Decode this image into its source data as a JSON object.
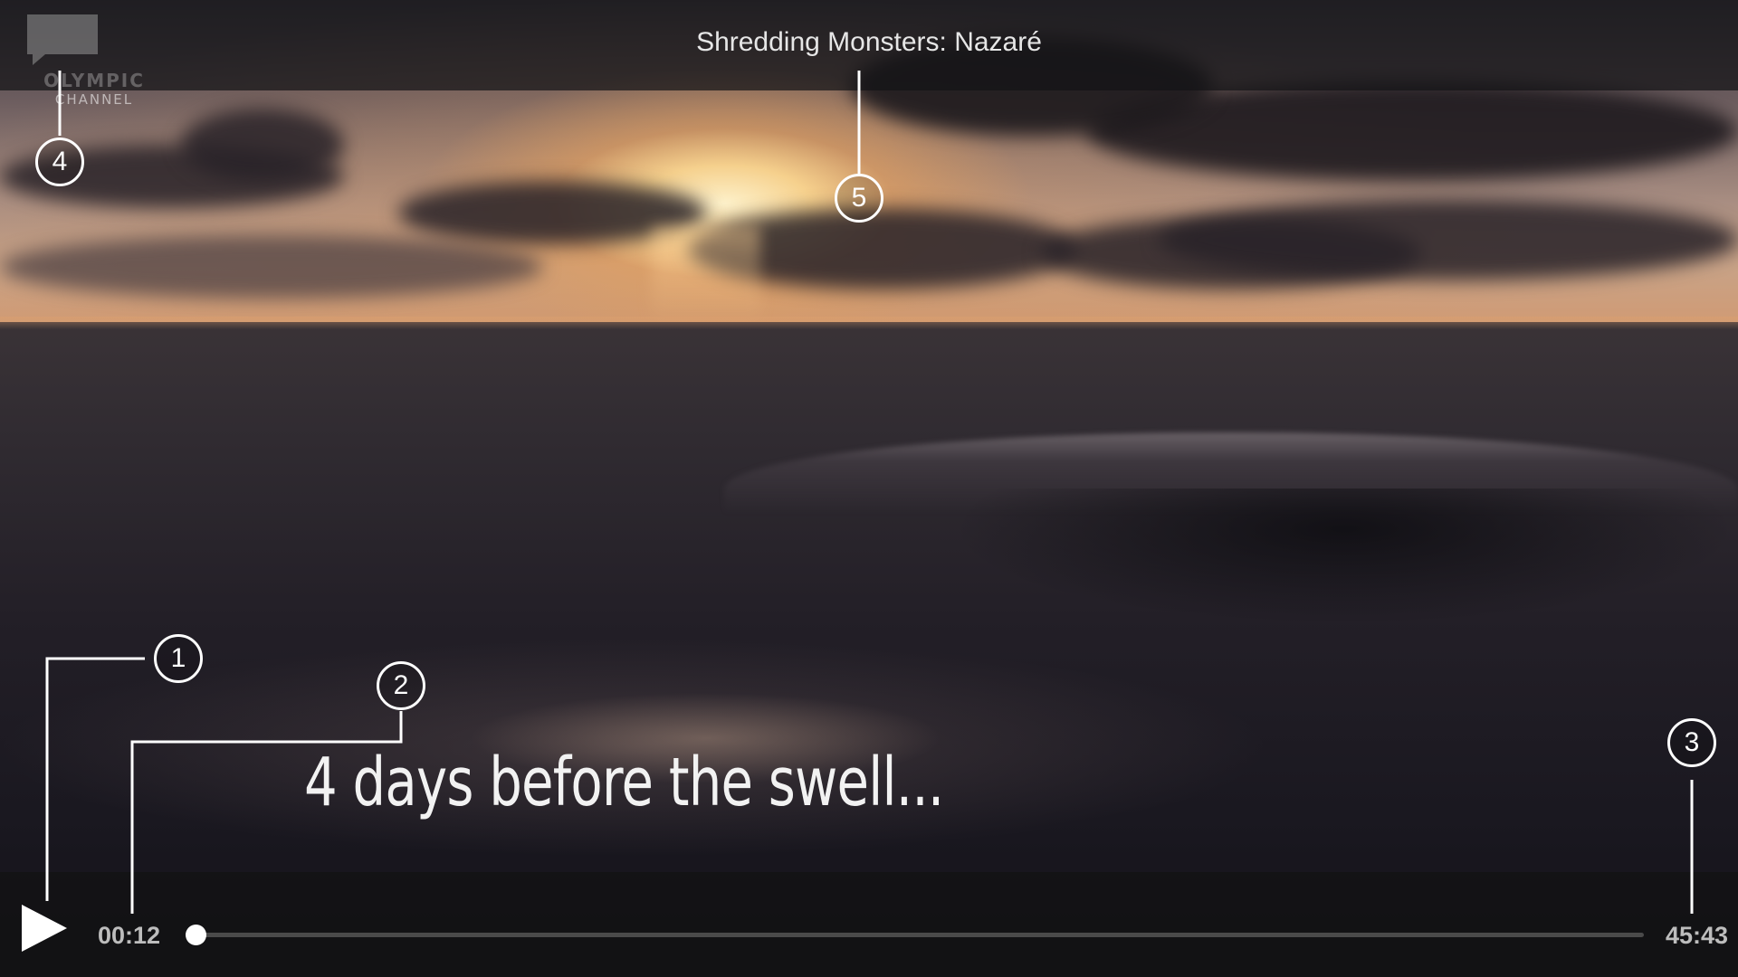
{
  "player": {
    "title": "Shredding Monsters: Nazaré",
    "subtitle_caption": "4 days before the swell...",
    "current_time": "00:12",
    "total_time": "45:43",
    "progress_fraction": 0.004,
    "watermark": {
      "line1": "OLYMPIC",
      "line2": "CHANNEL"
    },
    "icons": {
      "play": "play-icon",
      "subtitles": "subtitles-icon",
      "seek_handle": "seek-handle"
    }
  },
  "annotations": [
    {
      "number": "1"
    },
    {
      "number": "2"
    },
    {
      "number": "3"
    },
    {
      "number": "4"
    },
    {
      "number": "5"
    }
  ],
  "colors": {
    "annotation": "#ffffff",
    "chrome_text": "#e6e6e6",
    "time_text": "#bdbdbd",
    "seek_track": "#4a4a4a",
    "seek_handle": "#ffffff"
  }
}
